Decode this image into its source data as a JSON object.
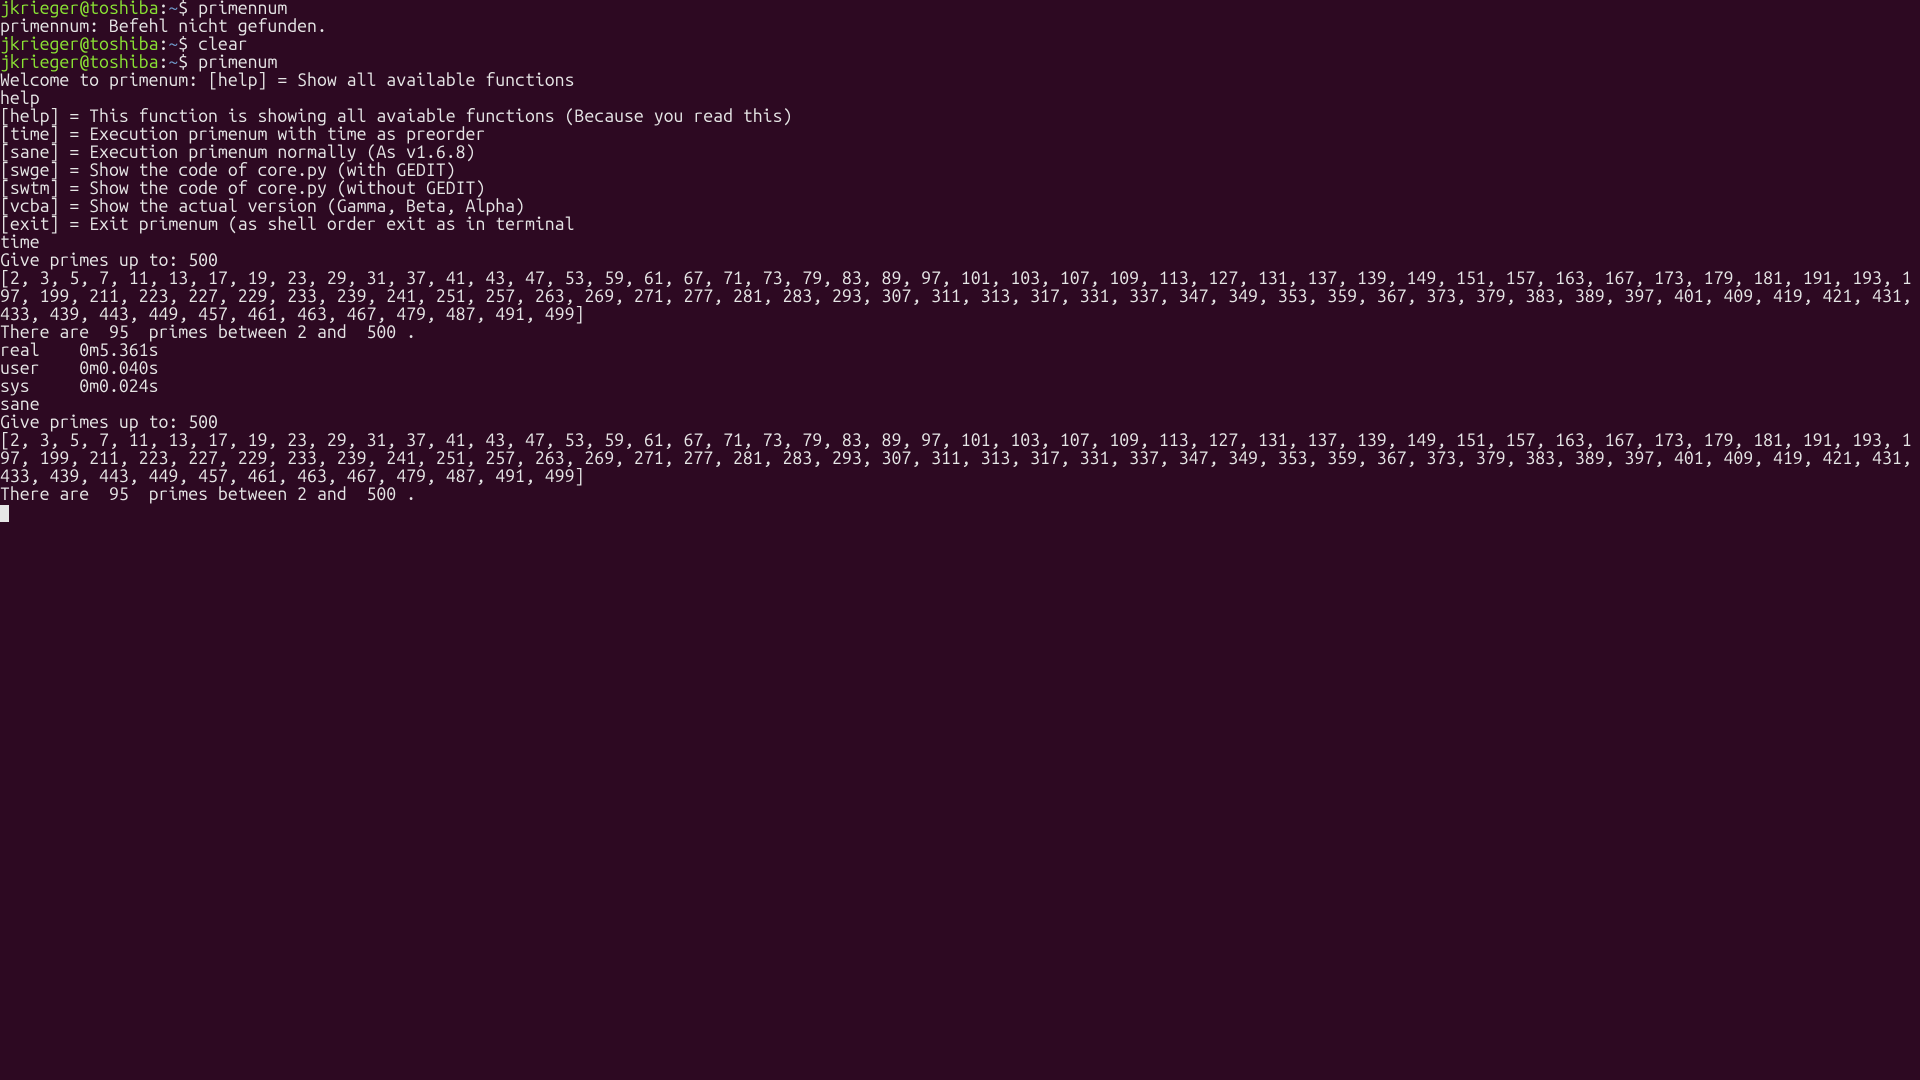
{
  "prompt": {
    "user_host": "jkrieger@toshiba",
    "sep": ":",
    "path": "~",
    "sigil": "$ "
  },
  "cmds": {
    "primennum": "primennum",
    "clear": "clear",
    "primenum": "primenum"
  },
  "l": {
    "err_notfound": "primennum: Befehl nicht gefunden.",
    "welcome": "Welcome to primenum: [help] = Show all available functions",
    "help_in": "help",
    "help1": "[help] = This function is showing all avaiable functions (Because you read this)",
    "help2": "[time] = Execution primenum with time as preorder",
    "help3": "[sane] = Execution primenum normally (As v1.6.8)",
    "help4": "[swge] = Show the code of core.py (with GEDIT)",
    "help5": "[swtm] = Show the code of core.py (without GEDIT)",
    "help6": "[vcba] = Show the actual version (Gamma, Beta, Alpha)",
    "help7": "[exit] = Exit primenum (as shell order exit as in terminal",
    "time_in": "time",
    "give500_1": "Give primes up to: 500",
    "primes": "[2, 3, 5, 7, 11, 13, 17, 19, 23, 29, 31, 37, 41, 43, 47, 53, 59, 61, 67, 71, 73, 79, 83, 89, 97, 101, 103, 107, 109, 113, 127, 131, 137, 139, 149, 151, 157, 163, 167, 173, 179, 181, 191, 193, 197, 199, 211, 223, 227, 229, 233, 239, 241, 251, 257, 263, 269, 271, 277, 281, 283, 293, 307, 311, 313, 317, 331, 337, 347, 349, 353, 359, 367, 373, 379, 383, 389, 397, 401, 409, 419, 421, 431, 433, 439, 443, 449, 457, 461, 463, 467, 479, 487, 491, 499]",
    "blank": "",
    "count": "There are  95  primes between 2 and  500 .",
    "t_real": "real    0m5.361s",
    "t_user": "user    0m0.040s",
    "t_sys": "sys     0m0.024s",
    "sane_in": "sane",
    "give500_2": "Give primes up to: 500"
  }
}
